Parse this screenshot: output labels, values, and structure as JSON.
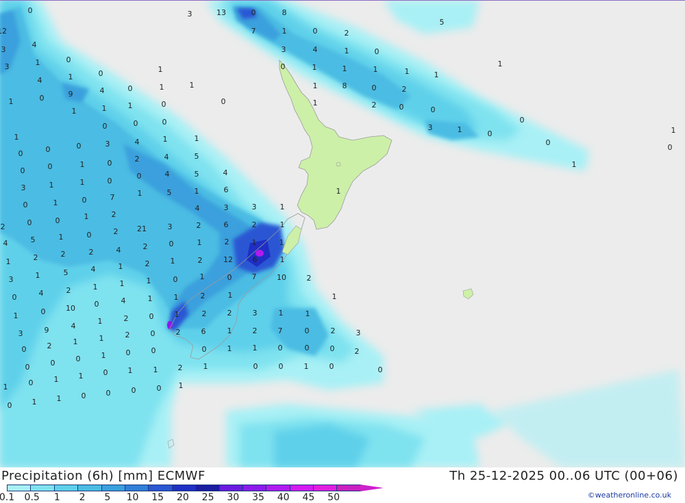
{
  "map": {
    "precip_values": [
      "0",
      "3",
      "13",
      "0",
      "8",
      "12",
      "7",
      "1",
      "0",
      "2",
      "3",
      "4",
      "3",
      "4",
      "1",
      "0",
      "5",
      "3",
      "1",
      "0",
      "1",
      "1",
      "1",
      "1",
      "4",
      "1",
      "0",
      "1",
      "1",
      "0",
      "1",
      "1",
      "1",
      "9",
      "4",
      "0",
      "1",
      "1",
      "8",
      "0",
      "0",
      "2",
      "0",
      "1",
      "0",
      "1",
      "2",
      "1",
      "1",
      "0",
      "0",
      "0",
      "0",
      "1",
      "0",
      "0",
      "1",
      "3",
      "1",
      "0",
      "1",
      "0",
      "0",
      "4",
      "3",
      "1",
      "0",
      "0",
      "0",
      "2",
      "4",
      "5",
      "0",
      "1",
      "0",
      "1",
      "0",
      "0",
      "4",
      "5",
      "4",
      "3",
      "1",
      "1",
      "0",
      "1",
      "6",
      "5",
      "1",
      "0",
      "1",
      "0",
      "1",
      "7",
      "4",
      "3",
      "3",
      "1",
      "2",
      "0",
      "0",
      "1",
      "2",
      "21",
      "3",
      "2",
      "6",
      "2",
      "1",
      "4",
      "5",
      "1",
      "0",
      "2",
      "0",
      "1",
      "2",
      "1",
      "1",
      "1",
      "2",
      "2",
      "2",
      "4",
      "2",
      "1",
      "2",
      "12",
      "6",
      "1",
      "3",
      "1",
      "5",
      "4",
      "1",
      "2",
      "0",
      "1",
      "0",
      "7",
      "10",
      "2",
      "0",
      "4",
      "2",
      "1",
      "1",
      "1",
      "1",
      "2",
      "1",
      "1",
      "1",
      "0",
      "10",
      "0",
      "4",
      "1",
      "1",
      "2",
      "2",
      "3",
      "1",
      "1",
      "3",
      "9",
      "4",
      "1",
      "2",
      "0",
      "2",
      "6",
      "1",
      "2",
      "7",
      "0",
      "2",
      "3",
      "0",
      "2",
      "1",
      "1",
      "2",
      "0",
      "0",
      "1",
      "1",
      "0",
      "0",
      "0",
      "0",
      "0",
      "0",
      "1",
      "0",
      "0",
      "2",
      "1",
      "0",
      "0",
      "1",
      "0",
      "2",
      "0",
      "1",
      "0",
      "1",
      "1",
      "0",
      "1",
      "1",
      "1",
      "0",
      "1",
      "1",
      "0",
      "0",
      "0",
      "0",
      "2",
      "1",
      "0",
      "1",
      "2",
      "2",
      "1",
      "0",
      "2",
      "1"
    ],
    "legend_colors": [
      "#a8f0f5",
      "#7fe2ef",
      "#5fd0ea",
      "#4bbce3",
      "#3aa0dd",
      "#2f7fd8",
      "#2a56d3",
      "#1f2fc4",
      "#1a1da0",
      "#6a1ae0",
      "#8c1aea",
      "#b01aef",
      "#d21af0",
      "#e01ee0",
      "#c820c0"
    ]
  },
  "footer": {
    "title": "Precipitation (6h) [mm] ECMWF",
    "datetime": "Th 25-12-2025 00..06 UTC (00+06)",
    "credit": "©weatheronline.co.uk",
    "legend_ticks": [
      "0.1",
      "0.5",
      "1",
      "2",
      "5",
      "10",
      "15",
      "20",
      "25",
      "30",
      "35",
      "40",
      "45",
      "50"
    ]
  }
}
